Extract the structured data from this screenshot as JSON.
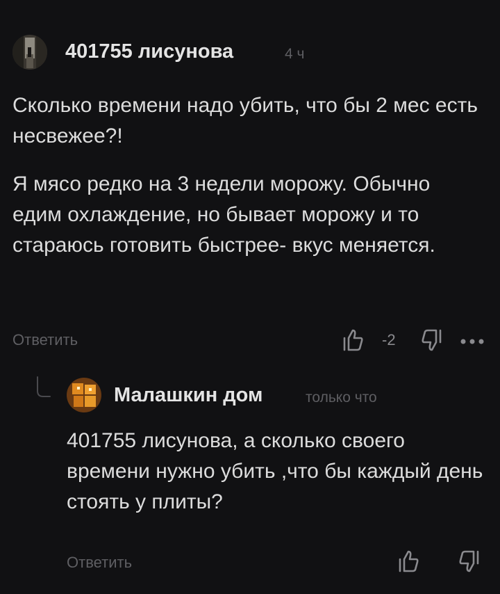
{
  "comments": [
    {
      "author": "401755 лисунова",
      "time": "4 ч",
      "paragraphs": [
        "Сколько времени надо убить, что бы 2 мес есть несвежее?!",
        "Я мясо редко на 3 недели морожу. Обычно едим охлаждение, но бывает морожу и то стараюсь готовить быстрее- вкус меняется."
      ],
      "reply_label": "Ответить",
      "rating": "-2"
    },
    {
      "author": "Малашкин дом",
      "time": "только что",
      "text": "401755 лисунова, а сколько своего времени нужно убить ,что бы каждый день стоять у плиты?",
      "reply_label": "Ответить"
    }
  ],
  "icons": {
    "upvote": "thumb-up-icon",
    "downvote": "thumb-down-icon",
    "more": "more-dots-icon",
    "thread": "thread-branch-icon"
  },
  "colors": {
    "background": "#111113",
    "text": "#dcdcdc",
    "muted": "#5f5f63"
  }
}
